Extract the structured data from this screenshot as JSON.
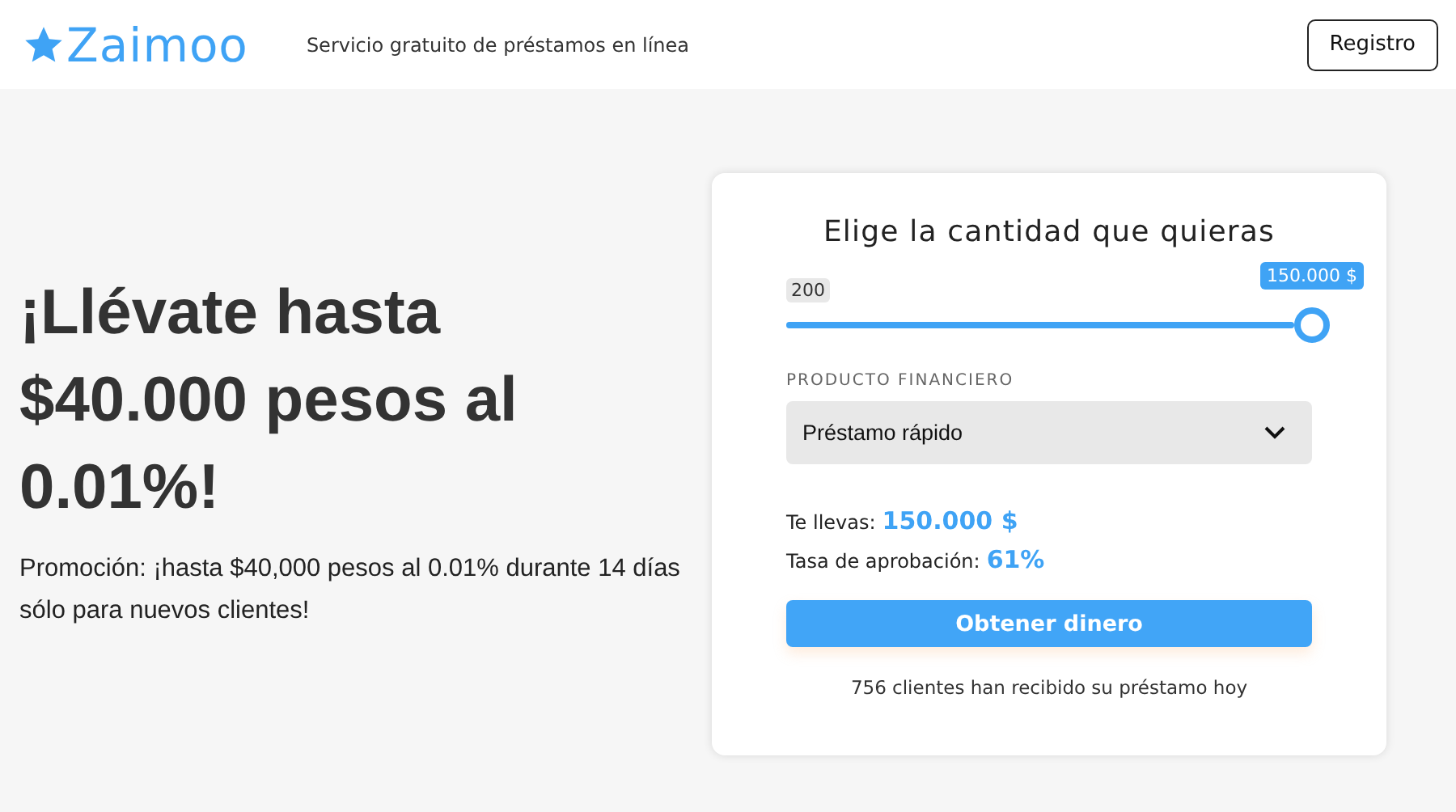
{
  "header": {
    "logo": "Zaimoo",
    "tagline": "Servicio gratuito de préstamos en línea",
    "register_button": "Registro"
  },
  "hero": {
    "headline": "¡Llévate hasta $40.000 pesos al 0.01%!",
    "promo": "Promoción: ¡hasta $40,000 pesos al 0.01% durante 14 días sólo para nuevos clientes!"
  },
  "calculator": {
    "title": "Elige la cantidad que quieras",
    "slider": {
      "min_label": "200",
      "value_label": "150.000 $",
      "level": 1
    },
    "product": {
      "label": "PRODUCTO FINANCIERO",
      "value": "Préstamo rápido"
    },
    "summary": [
      {
        "label": "Te llevas:",
        "value": "150.000 $"
      },
      {
        "label": "Tasa de aprobación:",
        "value": "61%"
      }
    ],
    "submit_button": "Obtener dinero",
    "footnote": "756 clientes han recibido su préstamo hoy"
  }
}
